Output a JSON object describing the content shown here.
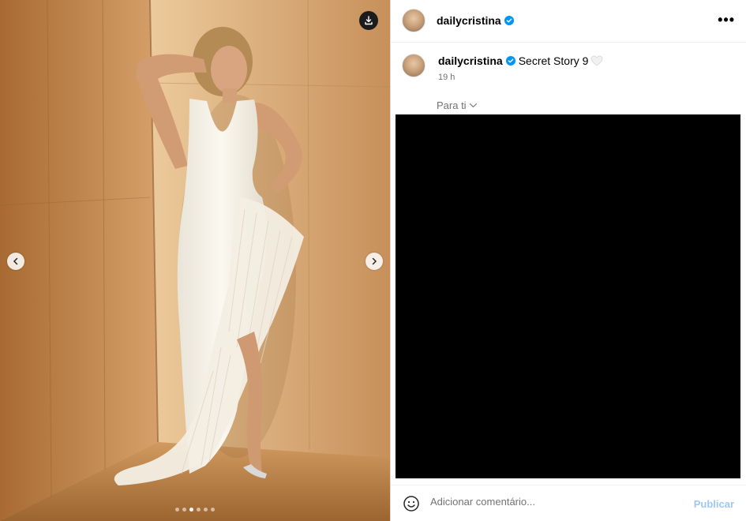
{
  "media": {
    "download_icon": "download-icon",
    "prev_icon": "chevron-left-icon",
    "next_icon": "chevron-right-icon",
    "carousel": {
      "count": 6,
      "active_index": 2
    }
  },
  "header": {
    "username": "dailycristina",
    "verified_icon": "verified-badge-icon",
    "more_icon": "more-options-icon",
    "more_label": "•••"
  },
  "caption": {
    "username": "dailycristina",
    "text": "Secret Story 9",
    "heart_icon": "white-heart-icon",
    "time": "19 h"
  },
  "translate": {
    "label": "Para ti",
    "icon": "chevron-down-icon"
  },
  "comment": {
    "emoji_icon": "emoji-icon",
    "placeholder": "Adicionar comentário...",
    "publish_label": "Publicar"
  },
  "colors": {
    "verified": "#0095f6",
    "publish_disabled": "#9fc7f5",
    "meta_text": "#737373",
    "video_bg": "#000000"
  }
}
